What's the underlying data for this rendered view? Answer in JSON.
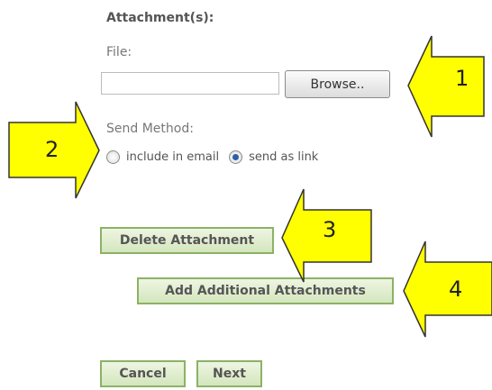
{
  "form": {
    "attachments_heading": "Attachment(s):",
    "file_label": "File:",
    "file_value": "",
    "browse_label": "Browse..",
    "send_method_label": "Send Method:",
    "send_method_options": [
      {
        "label": "include in email",
        "selected": false
      },
      {
        "label": "send as link",
        "selected": true
      }
    ],
    "delete_label": "Delete Attachment",
    "add_label": "Add Additional Attachments",
    "cancel_label": "Cancel",
    "next_label": "Next"
  },
  "callouts": [
    {
      "number": "1"
    },
    {
      "number": "2"
    },
    {
      "number": "3"
    },
    {
      "number": "4"
    }
  ],
  "colors": {
    "callout_fill": "#ffff00",
    "button_border": "#8cb265",
    "radio_selected": "#2b5fa8"
  }
}
